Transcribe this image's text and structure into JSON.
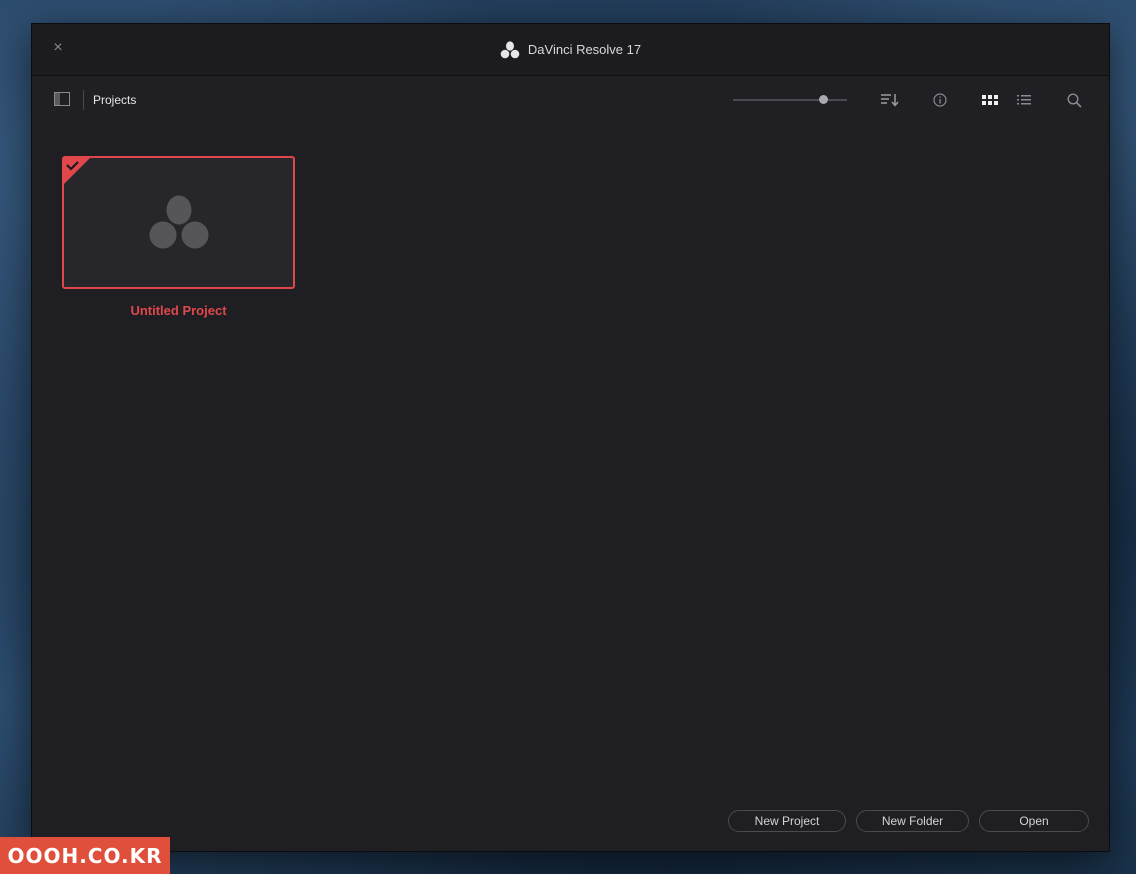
{
  "window": {
    "title": "DaVinci Resolve 17",
    "close_glyph": "×"
  },
  "toolbar": {
    "breadcrumb": "Projects",
    "thumbnail_size_fraction": 0.79,
    "icons": [
      "panel-toggle-icon",
      "sort-icon",
      "info-icon",
      "grid-view-icon",
      "list-view-icon",
      "search-icon"
    ]
  },
  "projects": [
    {
      "name": "Untitled Project",
      "selected": true
    }
  ],
  "footer": {
    "new_project": "New Project",
    "new_folder": "New Folder",
    "open": "Open"
  },
  "watermark": {
    "text": "OOOH.CO.KR"
  },
  "colors": {
    "accent": "#e0474b",
    "background": "#1f1f23",
    "watermark": "#e04f3b"
  }
}
